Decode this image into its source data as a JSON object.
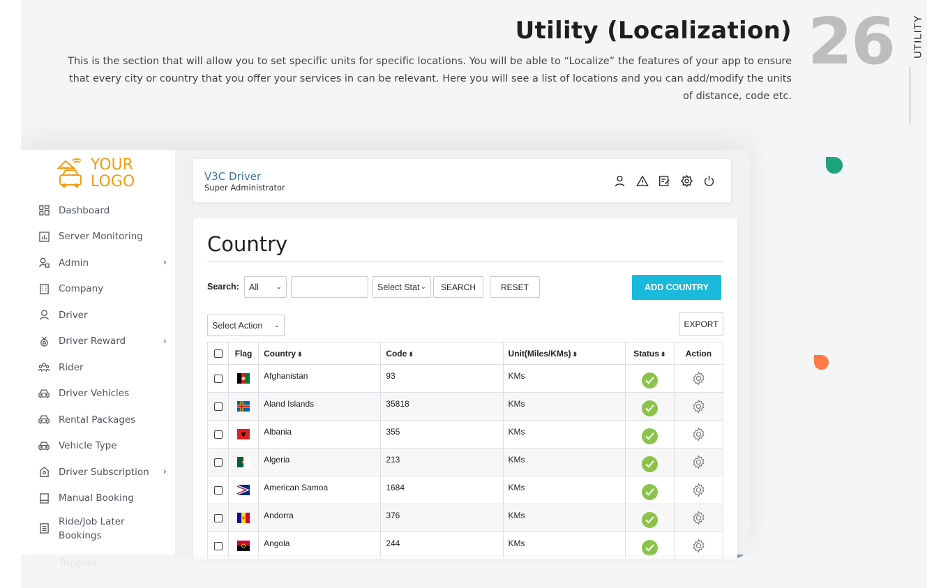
{
  "header": {
    "title": "Utility (Localization)",
    "description": "This is the section that will allow you to set specific units for specific locations. You will be able to “Localize” the features of your app to ensure that every city or country that you offer your services in can be relevant. Here you will see a list of locations and you can add/modify the units of distance, code etc.",
    "page_number": "26",
    "section_tag": "UTILITY"
  },
  "logo": {
    "line1": "YOUR",
    "line2": "LOGO",
    "badge": "TAXI"
  },
  "sidebar": {
    "items": [
      {
        "label": "Dashboard",
        "icon": "dashboard-icon",
        "has_chevron": false
      },
      {
        "label": "Server Monitoring",
        "icon": "chart-icon",
        "has_chevron": false
      },
      {
        "label": "Admin",
        "icon": "admin-user-icon",
        "has_chevron": true
      },
      {
        "label": "Company",
        "icon": "building-icon",
        "has_chevron": false
      },
      {
        "label": "Driver",
        "icon": "driver-icon",
        "has_chevron": false
      },
      {
        "label": "Driver Reward",
        "icon": "medal-icon",
        "has_chevron": true
      },
      {
        "label": "Rider",
        "icon": "users-icon",
        "has_chevron": false
      },
      {
        "label": "Driver Vehicles",
        "icon": "car-icon",
        "has_chevron": false
      },
      {
        "label": "Rental Packages",
        "icon": "car-icon",
        "has_chevron": false
      },
      {
        "label": "Vehicle Type",
        "icon": "car-icon",
        "has_chevron": false
      },
      {
        "label": "Driver Subscription",
        "icon": "subscription-icon",
        "has_chevron": true
      },
      {
        "label": "Manual Booking",
        "icon": "book-icon",
        "has_chevron": false
      },
      {
        "label": "Ride/Job Later Bookings",
        "icon": "list-icon",
        "has_chevron": false
      }
    ],
    "ghost_item": "Trip/Jobs"
  },
  "topbar": {
    "app_name": "V3C Driver",
    "role": "Super Administrator",
    "icons": [
      "user-icon",
      "alert-icon",
      "edit-icon",
      "settings-icon",
      "power-icon"
    ]
  },
  "main": {
    "title": "Country",
    "search": {
      "label": "Search:",
      "field_select": "All",
      "keyword_value": "",
      "status_select": "Select Stat",
      "search_button": "SEARCH",
      "reset_button": "RESET"
    },
    "add_button": "ADD COUNTRY",
    "action_select": "Select Action",
    "export_button": "EXPORT",
    "columns": [
      "Flag",
      "Country",
      "Code",
      "Unit(Miles/KMs)",
      "Status",
      "Action"
    ],
    "rows": [
      {
        "country": "Afghanistan",
        "code": "93",
        "unit": "KMs",
        "flag": "afghanistan"
      },
      {
        "country": "Aland Islands",
        "code": "35818",
        "unit": "KMs",
        "flag": "aland"
      },
      {
        "country": "Albania",
        "code": "355",
        "unit": "KMs",
        "flag": "albania"
      },
      {
        "country": "Algeria",
        "code": "213",
        "unit": "KMs",
        "flag": "algeria"
      },
      {
        "country": "American Samoa",
        "code": "1684",
        "unit": "KMs",
        "flag": "american-samoa"
      },
      {
        "country": "Andorra",
        "code": "376",
        "unit": "KMs",
        "flag": "andorra"
      },
      {
        "country": "Angola",
        "code": "244",
        "unit": "KMs",
        "flag": "angola"
      }
    ]
  },
  "colors": {
    "accent": "#1bb9db",
    "logo": "#f39c12",
    "status_active": "#8bc34a",
    "brand_link": "#3a70b0"
  }
}
